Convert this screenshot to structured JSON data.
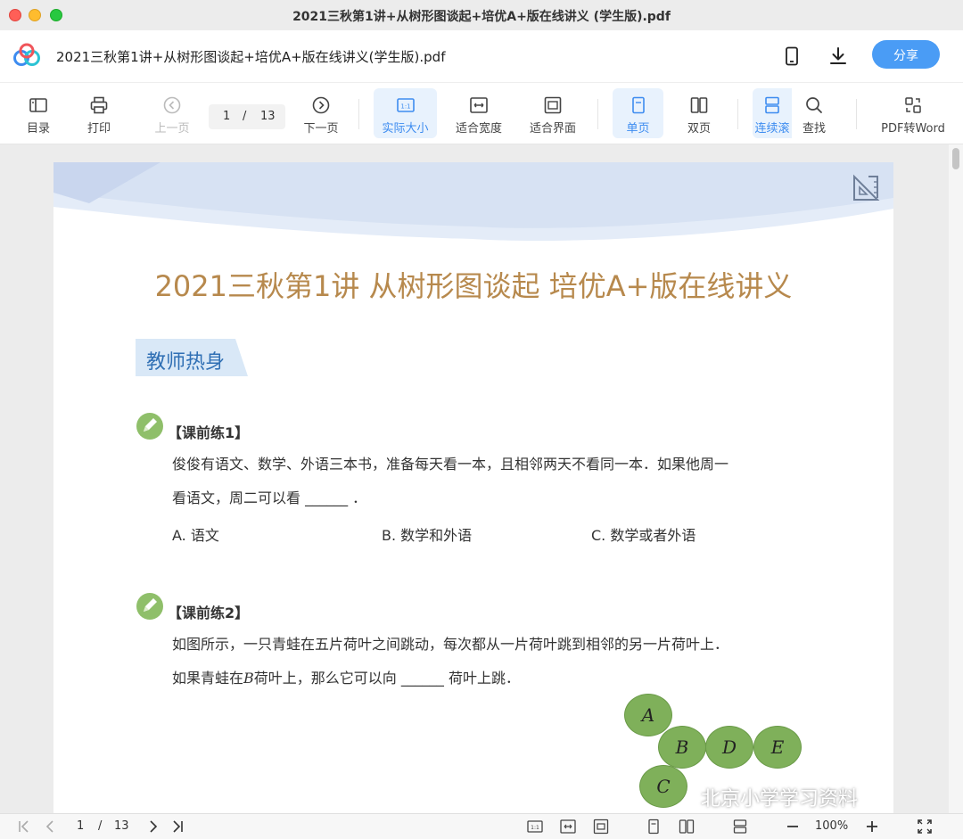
{
  "window": {
    "title": "2021三秋第1讲+从树形图谈起+培优A+版在线讲义 (学生版).pdf"
  },
  "header": {
    "doc_title": "2021三秋第1讲+从树形图谈起+培优A+版在线讲义(学生版).pdf",
    "share_label": "分享"
  },
  "toolbar": {
    "toc": "目录",
    "print": "打印",
    "prev": "上一页",
    "current_page": "1",
    "separator": "/",
    "total_pages": "13",
    "next": "下一页",
    "actual_size": "实际大小",
    "fit_width": "适合宽度",
    "fit_screen": "适合界面",
    "single": "单页",
    "double": "双页",
    "continuous": "连续滚",
    "search": "查找",
    "pdf_to_word": "PDF转Word"
  },
  "document": {
    "title": "2021三秋第1讲 从树形图谈起 培优A+版在线讲义",
    "section": "教师热身",
    "ex1": {
      "title": "【课前练1】",
      "line1": "俊俊有语文、数学、外语三本书，准备每天看一本，且相邻两天不看同一本．如果他周一",
      "line2": "看语文，周二可以看 ______ ．",
      "options": [
        "A. 语文",
        "B. 数学和外语",
        "C. 数学或者外语"
      ]
    },
    "ex2": {
      "title": "【课前练2】",
      "line1": "如图所示，一只青蛙在五片荷叶之间跳动，每次都从一片荷叶跳到相邻的另一片荷叶上．",
      "line2_a": "如果青蛙在",
      "line2_b": "B",
      "line2_c": "荷叶上，那么它可以向 ______ 荷叶上跳．"
    },
    "lily_pads": [
      "A",
      "B",
      "D",
      "E",
      "C"
    ],
    "watermark": "北京小学学习资料"
  },
  "statusbar": {
    "page": "1",
    "separator": "/",
    "total": "13",
    "zoom": "100%"
  },
  "colors": {
    "accent": "#4a9cf5",
    "title_gold": "#b7894d",
    "pad_green": "#7fb05a",
    "section_blue": "#2f6fb4"
  }
}
